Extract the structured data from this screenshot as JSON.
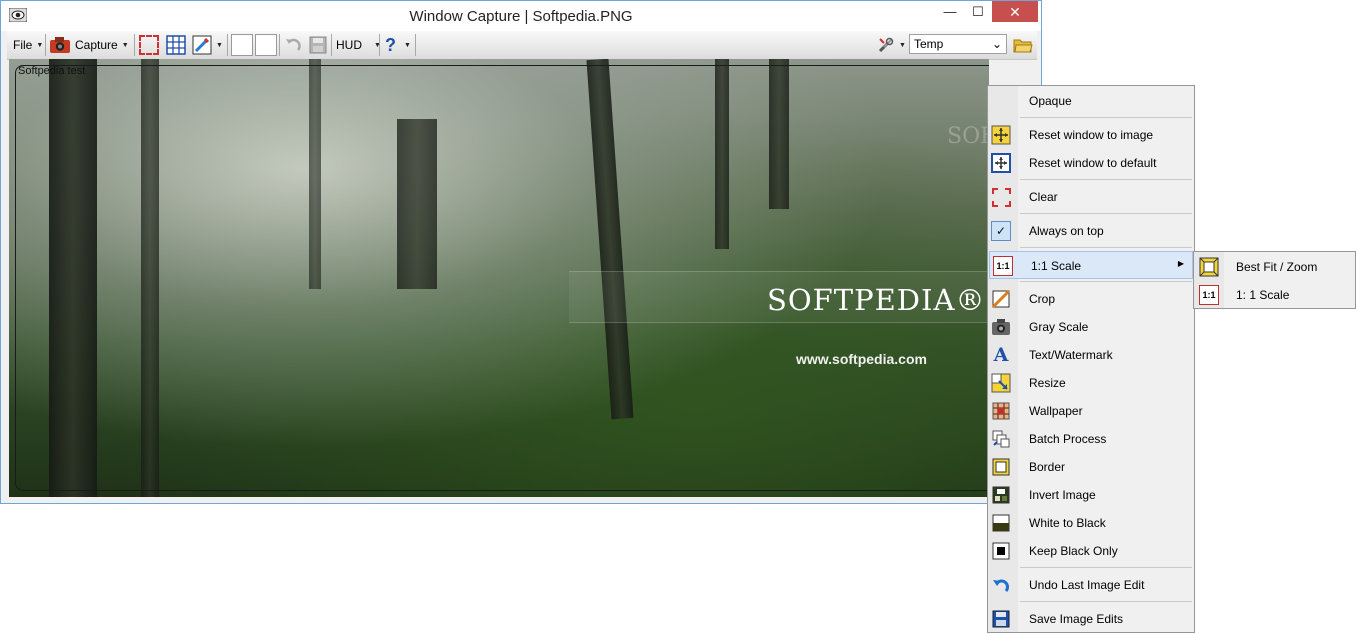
{
  "window": {
    "title": "Window Capture | Softpedia.PNG",
    "min_glyph": "—",
    "max_glyph": "☐",
    "close_glyph": "✕"
  },
  "toolbar": {
    "file_label": "File",
    "capture_label": "Capture",
    "hud_label": "HUD",
    "help_glyph": "?",
    "folder_combo_value": "Temp",
    "dropdown_glyph": "▼",
    "combo_arrow": "⌄"
  },
  "canvas": {
    "label": "Softpedia test",
    "watermark_logo": "SOFTPEDIA®",
    "watermark_url": "www.softpedia.com",
    "watermark_faint": "SOFTPEDIA"
  },
  "context_menu": {
    "items": [
      {
        "label": "Opaque",
        "icon": "none"
      },
      {
        "label": "Reset window to image",
        "icon": "reset-image-icon"
      },
      {
        "label": "Reset window to default",
        "icon": "reset-default-icon"
      },
      {
        "label": "Clear",
        "icon": "clear-selection-icon"
      },
      {
        "label": "Always on top",
        "icon": "checkbox-checked-icon",
        "check_glyph": "✓"
      },
      {
        "label": "1:1 Scale",
        "icon": "scale-1to1-icon",
        "icon_text": "1:1",
        "submenu_glyph": "▶"
      },
      {
        "label": "Crop",
        "icon": "crop-icon"
      },
      {
        "label": "Gray Scale",
        "icon": "camera-icon"
      },
      {
        "label": "Text/Watermark",
        "icon": "text-icon",
        "icon_text": "A"
      },
      {
        "label": "Resize",
        "icon": "resize-icon"
      },
      {
        "label": "Wallpaper",
        "icon": "wallpaper-icon"
      },
      {
        "label": "Batch Process",
        "icon": "batch-icon"
      },
      {
        "label": "Border",
        "icon": "border-icon"
      },
      {
        "label": "Invert Image",
        "icon": "invert-icon"
      },
      {
        "label": "White to Black",
        "icon": "white-to-black-icon"
      },
      {
        "label": "Keep Black Only",
        "icon": "keep-black-icon"
      },
      {
        "label": "Undo Last Image Edit",
        "icon": "undo-icon"
      },
      {
        "label": "Save Image Edits",
        "icon": "save-icon"
      }
    ]
  },
  "submenu": {
    "items": [
      {
        "label": "Best Fit / Zoom",
        "icon": "best-fit-icon"
      },
      {
        "label": "1: 1 Scale",
        "icon": "scale-1to1-icon",
        "icon_text": "1:1"
      }
    ]
  },
  "colors": {
    "accent_blue": "#1f4fa8",
    "close_red": "#c7504f",
    "highlight": "#dbe8f7"
  }
}
